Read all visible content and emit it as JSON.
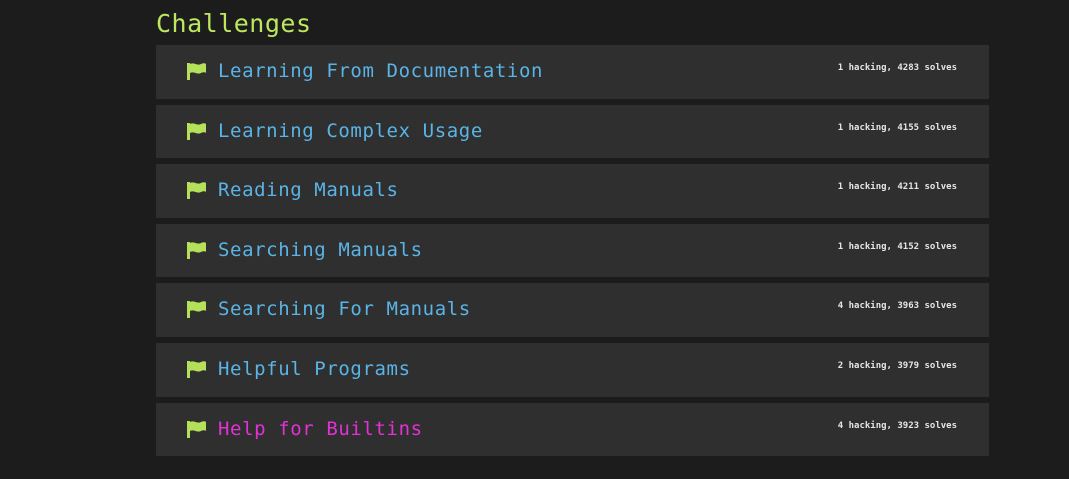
{
  "header": {
    "title": "Challenges"
  },
  "colors": {
    "background": "#1c1c1c",
    "row_background": "#2f2f2f",
    "title": "#bde75f",
    "flag": "#b5e05a",
    "link": "#5ab4e6",
    "active_link": "#e430d6",
    "meta": "#e6e6e6"
  },
  "challenges": [
    {
      "icon": "flag-icon",
      "title": "Learning From Documentation",
      "meta": "1 hacking, 4283 solves",
      "active": false
    },
    {
      "icon": "flag-icon",
      "title": "Learning Complex Usage",
      "meta": "1 hacking, 4155 solves",
      "active": false
    },
    {
      "icon": "flag-icon",
      "title": "Reading Manuals",
      "meta": "1 hacking, 4211 solves",
      "active": false
    },
    {
      "icon": "flag-icon",
      "title": "Searching Manuals",
      "meta": "1 hacking, 4152 solves",
      "active": false
    },
    {
      "icon": "flag-icon",
      "title": "Searching For Manuals",
      "meta": "4 hacking, 3963 solves",
      "active": false
    },
    {
      "icon": "flag-icon",
      "title": "Helpful Programs",
      "meta": "2 hacking, 3979 solves",
      "active": false
    },
    {
      "icon": "flag-icon",
      "title": "Help for Builtins",
      "meta": "4 hacking, 3923 solves",
      "active": true
    }
  ]
}
